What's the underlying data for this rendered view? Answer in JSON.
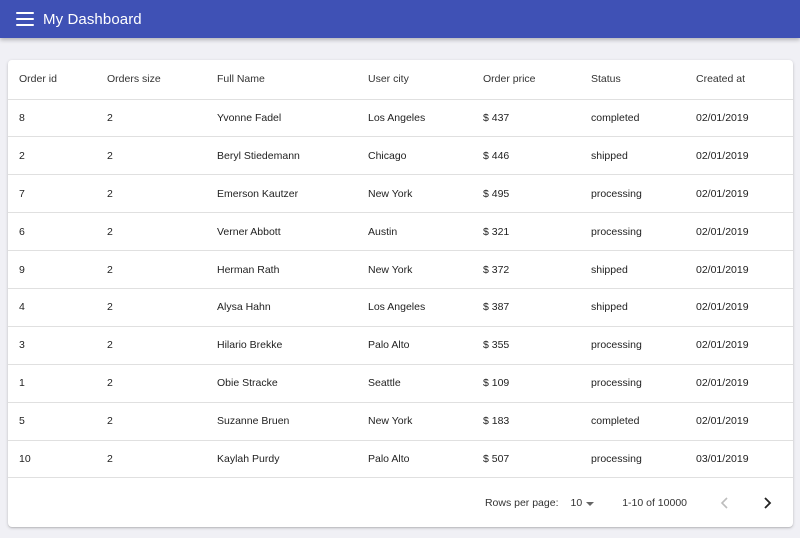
{
  "app": {
    "title": "My Dashboard"
  },
  "table": {
    "columns": [
      "Order id",
      "Orders size",
      "Full Name",
      "User city",
      "Order price",
      "Status",
      "Created at"
    ],
    "rows": [
      [
        "8",
        "2",
        "Yvonne Fadel",
        "Los Angeles",
        "$ 437",
        "completed",
        "02/01/2019"
      ],
      [
        "2",
        "2",
        "Beryl Stiedemann",
        "Chicago",
        "$ 446",
        "shipped",
        "02/01/2019"
      ],
      [
        "7",
        "2",
        "Emerson Kautzer",
        "New York",
        "$ 495",
        "processing",
        "02/01/2019"
      ],
      [
        "6",
        "2",
        "Verner Abbott",
        "Austin",
        "$ 321",
        "processing",
        "02/01/2019"
      ],
      [
        "9",
        "2",
        "Herman Rath",
        "New York",
        "$ 372",
        "shipped",
        "02/01/2019"
      ],
      [
        "4",
        "2",
        "Alysa Hahn",
        "Los Angeles",
        "$ 387",
        "shipped",
        "02/01/2019"
      ],
      [
        "3",
        "2",
        "Hilario Brekke",
        "Palo Alto",
        "$ 355",
        "processing",
        "02/01/2019"
      ],
      [
        "1",
        "2",
        "Obie Stracke",
        "Seattle",
        "$ 109",
        "processing",
        "02/01/2019"
      ],
      [
        "5",
        "2",
        "Suzanne Bruen",
        "New York",
        "$ 183",
        "completed",
        "02/01/2019"
      ],
      [
        "10",
        "2",
        "Kaylah Purdy",
        "Palo Alto",
        "$ 507",
        "processing",
        "03/01/2019"
      ]
    ]
  },
  "pagination": {
    "rows_per_page_label": "Rows per page:",
    "rows_per_page_value": "10",
    "range_label": "1-10 of 10000",
    "prev_icon": "chevron-left-icon",
    "next_icon": "chevron-right-icon"
  },
  "colors": {
    "appbar": "#3f51b5",
    "background": "#f0f0f5",
    "disabled_icon": "#bdbdbd"
  }
}
